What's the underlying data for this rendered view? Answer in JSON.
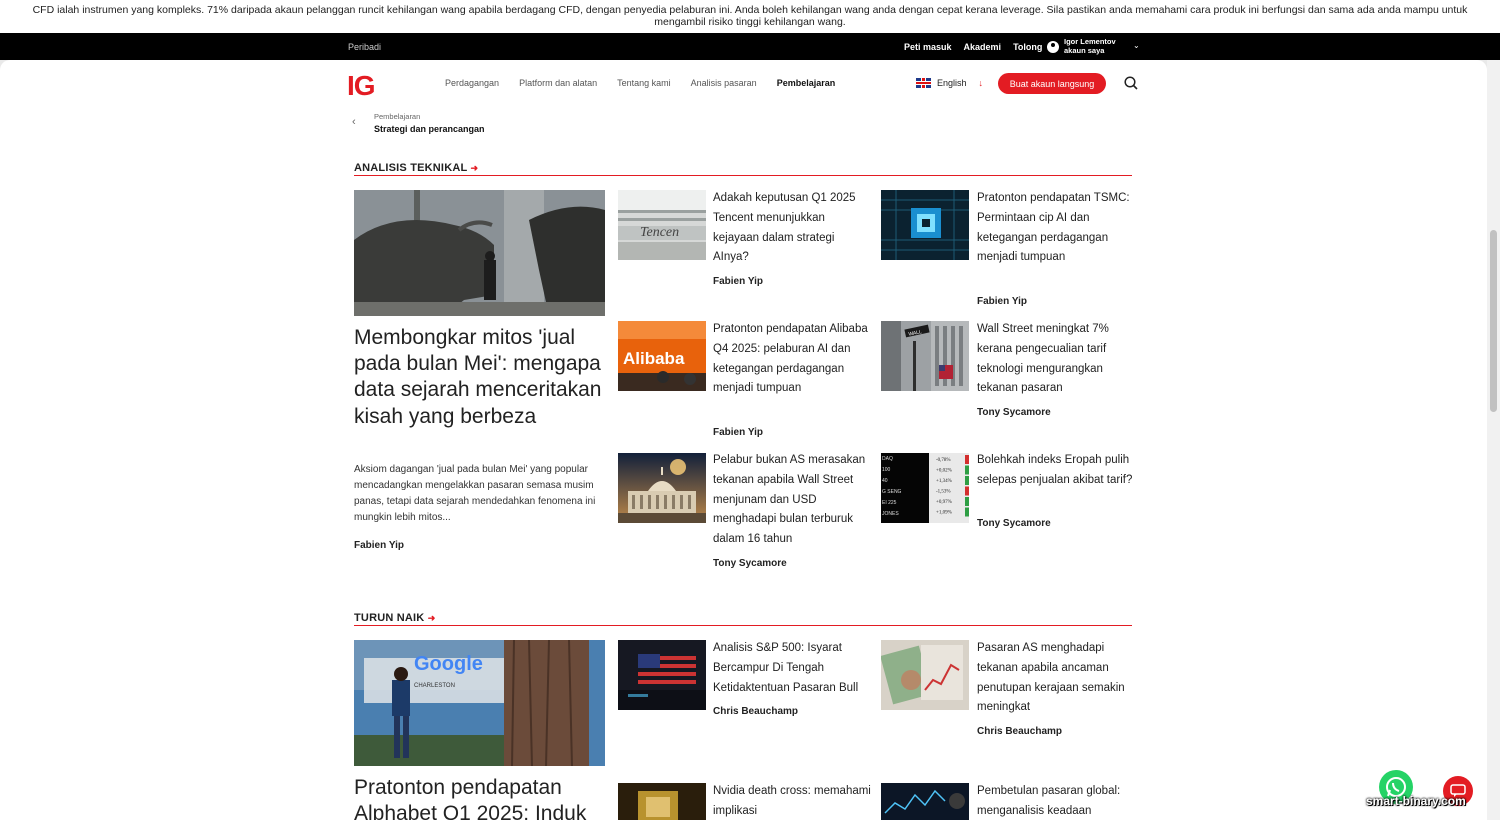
{
  "risk_warning": "CFD ialah instrumen yang kompleks. 71% daripada akaun pelanggan runcit kehilangan wang apabila berdagang CFD, dengan penyedia pelaburan ini. Anda boleh kehilangan wang anda dengan cepat kerana leverage. Sila pastikan anda memahami cara produk ini berfungsi dan sama ada anda mampu untuk mengambil risiko tinggi kehilangan wang.",
  "top_bar": {
    "personal": "Peribadi",
    "links": [
      "Peti masuk",
      "Akademi",
      "Tolong"
    ],
    "user_name": "Igor Lementov",
    "user_account": "akaun saya"
  },
  "header": {
    "logo": "IG",
    "nav": [
      "Perdagangan",
      "Platform dan alatan",
      "Tentang kami",
      "Analisis pasaran",
      "Pembelajaran"
    ],
    "active_nav": "Pembelajaran",
    "language": "English",
    "cta": "Buat akaun langsung"
  },
  "breadcrumb": {
    "parent": "Pembelajaran",
    "current": "Strategi dan perancangan"
  },
  "sections": [
    {
      "title": "ANALISIS TEKNIKAL",
      "featured": {
        "title": "Membongkar mitos 'jual pada bulan Mei': mengapa data sejarah menceritakan kisah yang berbeza",
        "description": "Aksiom dagangan 'jual pada bulan Mei' yang popular mencadangkan mengelakkan pasaran semasa musim panas, tetapi data sejarah mendedahkan fenomena ini mungkin lebih mitos...",
        "author": "Fabien Yip"
      },
      "articles": [
        {
          "title": "Adakah keputusan Q1 2025 Tencent menunjukkan kejayaan dalam strategi AInya?",
          "author": "Fabien Yip",
          "image_text": "Tencen"
        },
        {
          "title": "Pratonton pendapatan TSMC: Permintaan cip AI dan ketegangan perdagangan menjadi tumpuan",
          "author": "Fabien Yip"
        },
        {
          "title": "Pratonton pendapatan Alibaba Q4 2025: pelaburan AI dan ketegangan perdagangan menjadi tumpuan",
          "author": "Fabien Yip",
          "image_text": "Alibaba"
        },
        {
          "title": "Wall Street meningkat 7% kerana pengecualian tarif teknologi mengurangkan tekanan pasaran",
          "author": "Tony Sycamore",
          "image_text": "WALL"
        },
        {
          "title": "Pelabur bukan AS merasakan tekanan apabila Wall Street menjunam dan USD menghadapi bulan terburuk dalam 16 tahun",
          "author": "Tony Sycamore"
        },
        {
          "title": "Bolehkah indeks Eropah pulih selepas penjualan akibat tarif?",
          "author": "Tony Sycamore",
          "image_ticker": [
            "-0,78%",
            "+0,02%",
            "+1,34%",
            "-1,53%",
            "+0,97%",
            "+1,09%"
          ],
          "image_labels": [
            "DAQ",
            "100",
            "40",
            "G SENG",
            "EI 225",
            "JONES"
          ]
        }
      ]
    },
    {
      "title": "TURUN NAIK",
      "featured": {
        "title": "Pratonton pendapatan Alphabet Q1 2025: Induk",
        "image_text": "Google",
        "image_subtext": "CHARLESTON"
      },
      "articles": [
        {
          "title": "Analisis S&P 500: Isyarat Bercampur Di Tengah Ketidaktentuan Pasaran Bull",
          "author": "Chris Beauchamp"
        },
        {
          "title": "Pasaran AS menghadapi tekanan apabila ancaman penutupan kerajaan semakin meningkat",
          "author": "Chris Beauchamp"
        },
        {
          "title": "Nvidia death cross: memahami implikasi"
        },
        {
          "title": "Pembetulan pasaran global: menganalisis keadaan"
        }
      ]
    }
  ],
  "watermark": "smart-binary.com",
  "colors": {
    "brand": "#e31c23",
    "dark": "#000000",
    "whatsapp": "#25d366"
  },
  "icons": [
    "user-icon",
    "chevron-down-icon",
    "search-icon",
    "chevron-left-icon",
    "arrow-right-icon",
    "whatsapp-icon",
    "chat-icon"
  ]
}
